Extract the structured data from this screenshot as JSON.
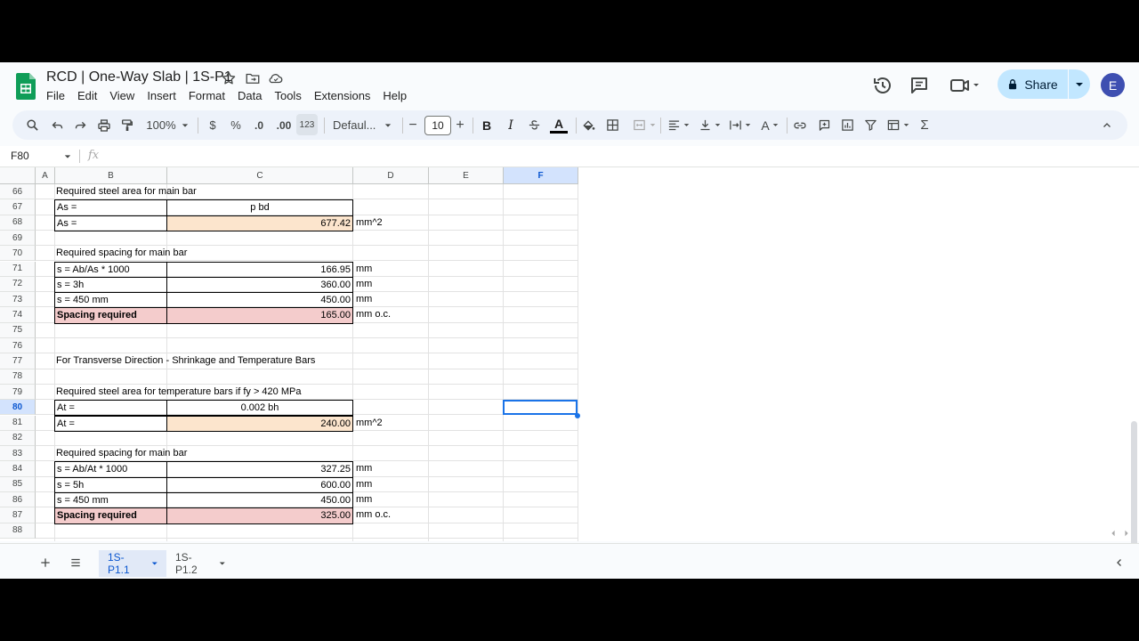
{
  "doc": {
    "title": "RCD | One-Way Slab | 1S-P1",
    "menus": [
      "File",
      "Edit",
      "View",
      "Insert",
      "Format",
      "Data",
      "Tools",
      "Extensions",
      "Help"
    ],
    "share_label": "Share",
    "avatar_letter": "E"
  },
  "toolbar": {
    "zoom": "100%",
    "currency": "$",
    "percent": "%",
    "dec_less": ".0",
    "dec_more": ".00",
    "number_format": "123",
    "font": "Defaul...",
    "font_size": "10",
    "bold": "B",
    "italic": "I",
    "sum": "Σ"
  },
  "formula_bar": {
    "name_box": "F80",
    "fx": "fx",
    "content": ""
  },
  "grid": {
    "columns": [
      "A",
      "B",
      "C",
      "D",
      "E",
      "F"
    ],
    "selected_column": "F",
    "rows": [
      {
        "n": "66",
        "b": "Required steel area for main bar",
        "c": "",
        "d": "",
        "style": "text"
      },
      {
        "n": "67",
        "b": "As =",
        "c": "p bd",
        "d": "",
        "style": "box-center"
      },
      {
        "n": "68",
        "b": "As =",
        "c": "677.42",
        "d": "mm^2",
        "style": "box-peach"
      },
      {
        "n": "69",
        "b": "",
        "c": "",
        "d": "",
        "style": "empty"
      },
      {
        "n": "70",
        "b": "Required spacing for main bar",
        "c": "",
        "d": "",
        "style": "text"
      },
      {
        "n": "71",
        "b": "s = Ab/As * 1000",
        "c": "166.95",
        "d": "mm",
        "style": "box"
      },
      {
        "n": "72",
        "b": "s = 3h",
        "c": "360.00",
        "d": "mm",
        "style": "box"
      },
      {
        "n": "73",
        "b": "s = 450 mm",
        "c": "450.00",
        "d": "mm",
        "style": "box"
      },
      {
        "n": "74",
        "b": "Spacing  required",
        "c": "165.00",
        "d": "mm o.c.",
        "style": "box-pink"
      },
      {
        "n": "75",
        "b": "",
        "c": "",
        "d": "",
        "style": "empty"
      },
      {
        "n": "76",
        "b": "",
        "c": "",
        "d": "",
        "style": "empty"
      },
      {
        "n": "77",
        "b": "For Transverse Direction - Shrinkage and Temperature Bars",
        "c": "",
        "d": "",
        "style": "text"
      },
      {
        "n": "78",
        "b": "",
        "c": "",
        "d": "",
        "style": "empty"
      },
      {
        "n": "79",
        "b": "Required steel area for temperature bars if fy > 420 MPa",
        "c": "",
        "d": "",
        "style": "text"
      },
      {
        "n": "80",
        "b": "At =",
        "c": "0.002 bh",
        "d": "",
        "style": "box-center"
      },
      {
        "n": "81",
        "b": "At =",
        "c": "240.00",
        "d": "mm^2",
        "style": "box-peach"
      },
      {
        "n": "82",
        "b": "",
        "c": "",
        "d": "",
        "style": "empty"
      },
      {
        "n": "83",
        "b": "Required spacing for main bar",
        "c": "",
        "d": "",
        "style": "text"
      },
      {
        "n": "84",
        "b": "s = Ab/At * 1000",
        "c": "327.25",
        "d": "mm",
        "style": "box"
      },
      {
        "n": "85",
        "b": "s = 5h",
        "c": "600.00",
        "d": "mm",
        "style": "box"
      },
      {
        "n": "86",
        "b": "s = 450 mm",
        "c": "450.00",
        "d": "mm",
        "style": "box"
      },
      {
        "n": "87",
        "b": "Spacing  required",
        "c": "325.00",
        "d": "mm o.c.",
        "style": "box-pink"
      },
      {
        "n": "88",
        "b": "",
        "c": "",
        "d": "",
        "style": "empty"
      }
    ],
    "selected_row": "80"
  },
  "sheets": {
    "tabs": [
      {
        "label": "1S-P1.1",
        "active": true
      },
      {
        "label": "1S-P1.2",
        "active": false
      }
    ]
  },
  "colors": {
    "peach": "#fce5cd",
    "pink": "#f4cccc",
    "selection": "#1a73e8",
    "share_bg": "#c2e7ff"
  }
}
